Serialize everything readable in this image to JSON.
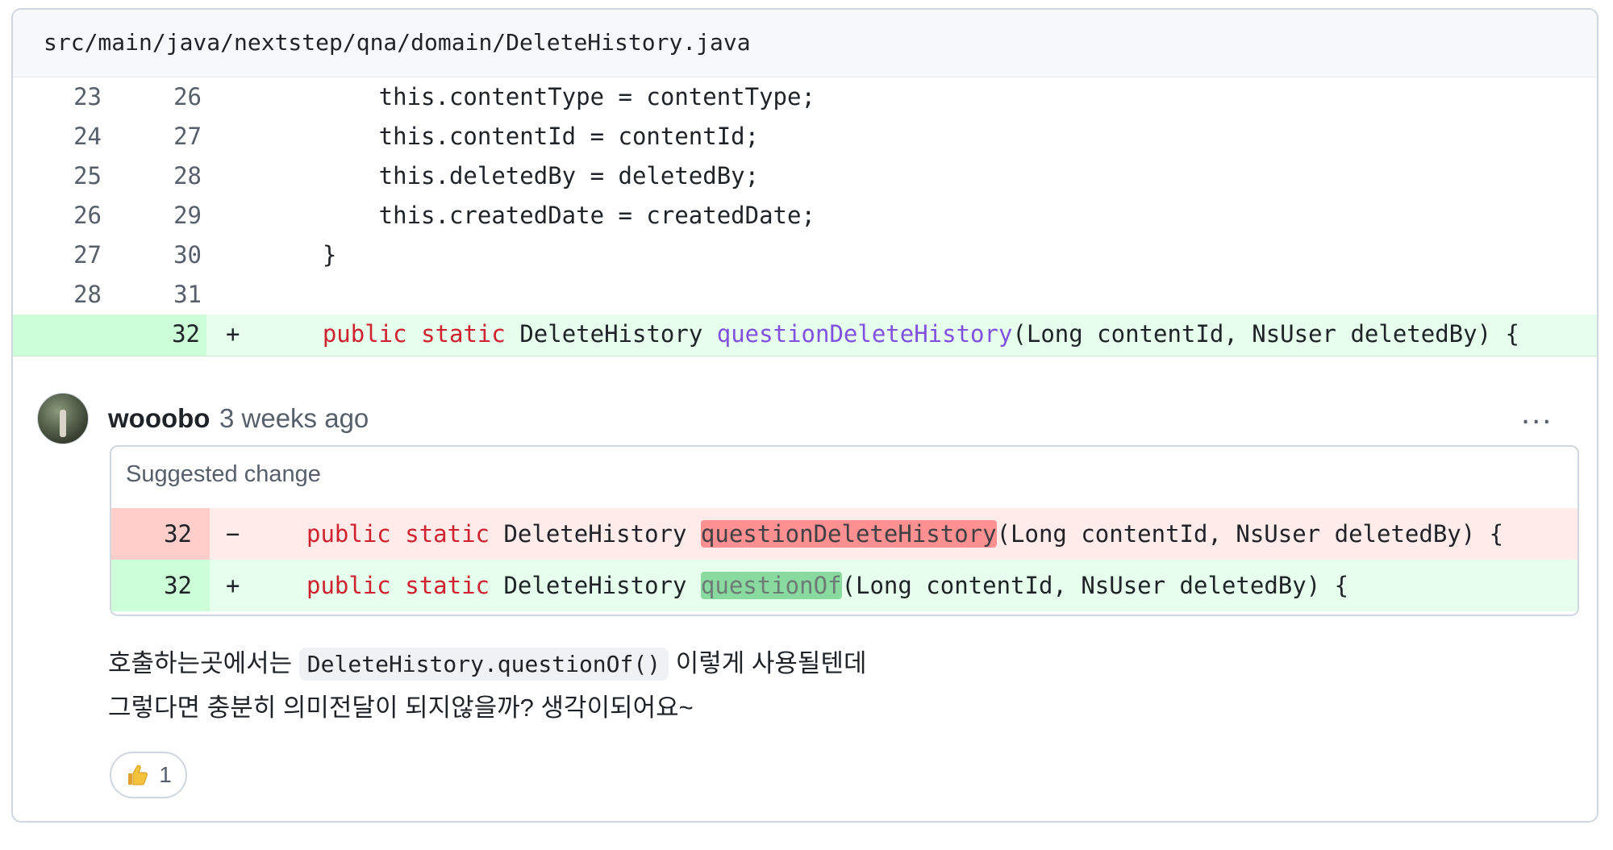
{
  "file": {
    "path": "src/main/java/nextstep/qna/domain/DeleteHistory.java"
  },
  "diff": {
    "rows": [
      {
        "old": "23",
        "new": "26",
        "code": "        this.contentType = contentType;"
      },
      {
        "old": "24",
        "new": "27",
        "code": "        this.contentId = contentId;"
      },
      {
        "old": "25",
        "new": "28",
        "code": "        this.deletedBy = deletedBy;"
      },
      {
        "old": "26",
        "new": "29",
        "code": "        this.createdDate = createdDate;"
      },
      {
        "old": "27",
        "new": "30",
        "code": "    }"
      },
      {
        "old": "28",
        "new": "31",
        "code": ""
      }
    ],
    "added": {
      "new": "32",
      "marker": "+",
      "indent": "    ",
      "kw1": "public",
      "kw2": "static",
      "type": "DeleteHistory",
      "fn": "questionDeleteHistory",
      "rest": "(Long contentId, NsUser deletedBy) {"
    }
  },
  "comment": {
    "author": "wooobo",
    "time": "3 weeks ago",
    "more": "...",
    "suggestion": {
      "title": "Suggested change",
      "removed": {
        "ln": "32",
        "marker": "−",
        "kw1": "public",
        "kw2": "static",
        "type": "DeleteHistory",
        "fn": "questionDeleteHistory",
        "rest": "(Long contentId, NsUser deletedBy) {"
      },
      "added": {
        "ln": "32",
        "marker": "+",
        "kw1": "public",
        "kw2": "static",
        "type": "DeleteHistory",
        "fn": "questionOf",
        "rest": "(Long contentId, NsUser deletedBy) {"
      }
    },
    "body": {
      "line1_before": "호출하는곳에서는",
      "line1_code": "DeleteHistory.questionOf()",
      "line1_after": "이렇게 사용될텐데",
      "line2": "그렇다면 충분히 의미전달이 되지않을까? 생각이되어요~"
    },
    "reaction": {
      "icon": "thumbs-up-icon",
      "count": "1"
    }
  },
  "colors": {
    "added_bg": "#e6ffec",
    "removed_bg": "#ffebe9",
    "keyword": "#cf222e",
    "function": "#8250df"
  }
}
